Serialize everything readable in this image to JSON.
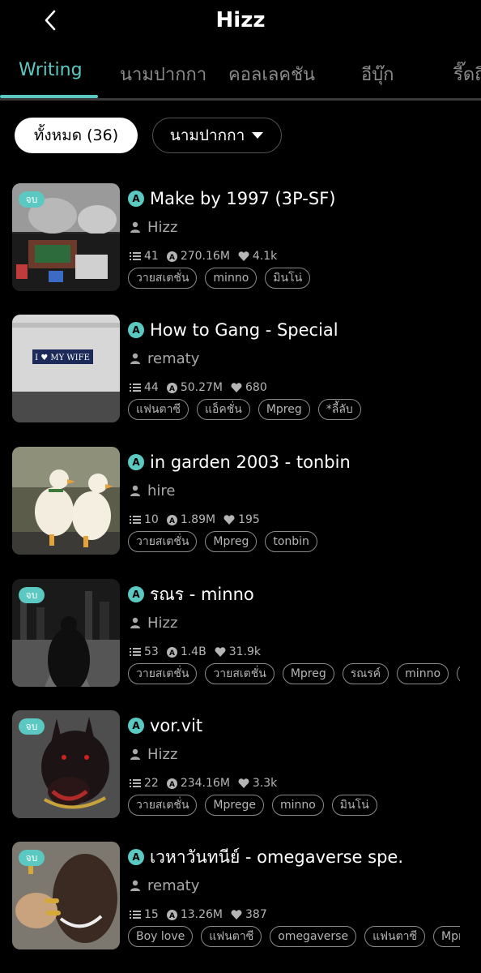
{
  "header": {
    "title": "Hizz"
  },
  "tabs": [
    {
      "label": "Writing"
    },
    {
      "label": "นามปากกา"
    },
    {
      "label": "คอลเลคชัน"
    },
    {
      "label": "อีบุ๊ก"
    },
    {
      "label": "รี๊ดถึ"
    }
  ],
  "filters": {
    "all_label": "ทั้งหมด (36)",
    "pen_label": "นามปากกา"
  },
  "accent_color": "#5bc9c2",
  "stories": [
    {
      "title": "Make by 1997 (3P-SF)",
      "author": "Hizz",
      "completed": true,
      "badge": "จบ",
      "chapters": "41",
      "reads": "270.16M",
      "likes": "4.1k",
      "tags": [
        "วายสเตชั่น",
        "minno",
        "มินโน่"
      ]
    },
    {
      "title": "How to Gang - Special",
      "author": "rematy",
      "completed": false,
      "badge": "",
      "chapters": "44",
      "reads": "50.27M",
      "likes": "680",
      "tags": [
        "แฟนตาซี",
        "แอ็คชั่น",
        "Mpreg",
        "*ลี้ลับ"
      ]
    },
    {
      "title": "in garden 2003 - tonbin",
      "author": "hire",
      "completed": false,
      "badge": "",
      "chapters": "10",
      "reads": "1.89M",
      "likes": "195",
      "tags": [
        "วายสเตชั่น",
        "Mpreg",
        "tonbin"
      ]
    },
    {
      "title": "รณร - minno",
      "author": "Hizz",
      "completed": true,
      "badge": "จบ",
      "chapters": "53",
      "reads": "1.4B",
      "likes": "31.9k",
      "tags": [
        "วายสเตชั่น",
        "วายสเตชั่น",
        "Mpreg",
        "รณรค์",
        "minno",
        "มิ"
      ]
    },
    {
      "title": "vor.vit",
      "author": "Hizz",
      "completed": true,
      "badge": "จบ",
      "chapters": "22",
      "reads": "234.16M",
      "likes": "3.3k",
      "tags": [
        "วายสเตชั่น",
        "Mprege",
        "minno",
        "มินโน่"
      ]
    },
    {
      "title": "เวหาวันทนีย์ - omegaverse spe.",
      "author": "rematy",
      "completed": true,
      "badge": "จบ",
      "chapters": "15",
      "reads": "13.26M",
      "likes": "387",
      "tags": [
        "Boy love",
        "แฟนตาซี",
        "omegaverse",
        "แฟนตาซี",
        "Mpre"
      ]
    }
  ],
  "icons": {
    "back": "chevron-left-icon",
    "dropdown": "caret-down-icon",
    "reads": "a-coin-icon",
    "author": "person-icon",
    "chapters": "list-icon",
    "likes": "heart-icon"
  }
}
